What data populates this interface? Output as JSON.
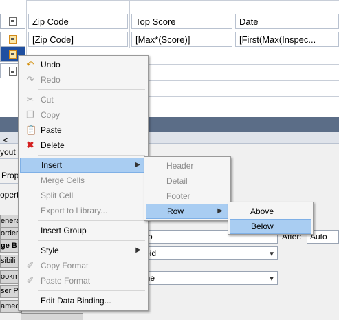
{
  "grid": {
    "headers": [
      "Zip Code",
      "Top Score",
      "Date"
    ],
    "values": [
      "[Zip Code]",
      "[Max*(Score)]",
      "[First(Max(Inspec..."
    ]
  },
  "panel": {
    "side_tabs": [
      "enera",
      "order",
      "ge B",
      "sibili",
      "ookm",
      "ser P",
      "amed"
    ],
    "labels": {
      "you": "yout",
      "prop": "Prop",
      "opert": "opert"
    },
    "fields": {
      "auto1": "uto",
      "after_label": "After:",
      "auto2": "Auto",
      "void": "void",
      "none": "one"
    }
  },
  "context_menu": {
    "items": [
      {
        "label": "Undo",
        "icon": "undo-icon"
      },
      {
        "label": "Redo",
        "icon": "redo-icon",
        "disabled": true
      },
      {
        "label": "Cut",
        "icon": "cut-icon",
        "disabled": true
      },
      {
        "label": "Copy",
        "icon": "copy-icon",
        "disabled": true
      },
      {
        "label": "Paste",
        "icon": "paste-icon"
      },
      {
        "label": "Delete",
        "icon": "delete-icon"
      },
      {
        "label": "Insert",
        "submenu": true
      },
      {
        "label": "Merge Cells",
        "disabled": true
      },
      {
        "label": "Split Cell",
        "disabled": true
      },
      {
        "label": "Export to Library...",
        "disabled": true
      },
      {
        "label": "Insert Group"
      },
      {
        "label": "Style",
        "submenu": true
      },
      {
        "label": "Copy Format",
        "icon": "copy-format-icon",
        "disabled": true
      },
      {
        "label": "Paste Format",
        "icon": "paste-format-icon",
        "disabled": true
      },
      {
        "label": "Edit Data Binding..."
      }
    ]
  },
  "insert_submenu": {
    "items": [
      {
        "label": "Header",
        "disabled": true
      },
      {
        "label": "Detail",
        "disabled": true
      },
      {
        "label": "Footer",
        "disabled": true
      },
      {
        "label": "Row",
        "submenu": true
      }
    ]
  },
  "row_submenu": {
    "items": [
      {
        "label": "Above"
      },
      {
        "label": "Below"
      }
    ]
  }
}
